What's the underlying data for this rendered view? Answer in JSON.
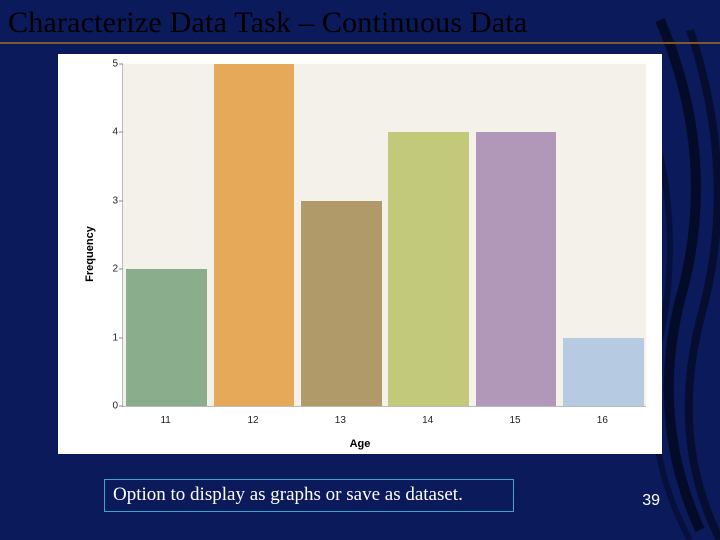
{
  "slide": {
    "title": "Characterize Data Task – Continuous Data",
    "caption": "Option to display as graphs or save as dataset.",
    "page_number": "39"
  },
  "chart_data": {
    "type": "bar",
    "title": "",
    "xlabel": "Age",
    "ylabel": "Frequency",
    "categories": [
      "11",
      "12",
      "13",
      "14",
      "15",
      "16"
    ],
    "values": [
      2,
      5,
      3,
      4,
      4,
      1
    ],
    "ylim": [
      0,
      5
    ],
    "yticks": [
      0,
      1,
      2,
      3,
      4,
      5
    ],
    "colors": [
      "#8aad8c",
      "#e6a95a",
      "#b09a6a",
      "#c3c97a",
      "#b198b8",
      "#b6cbe2"
    ]
  }
}
